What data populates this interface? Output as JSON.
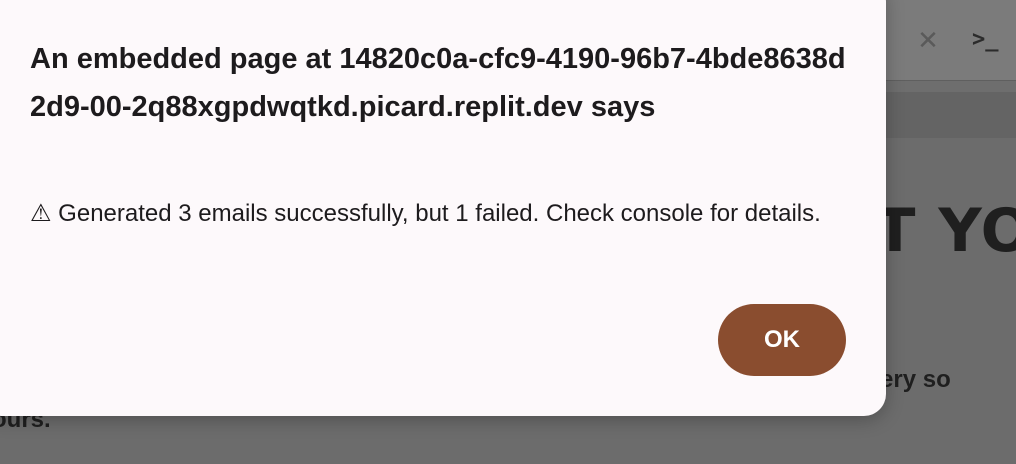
{
  "background": {
    "close_glyph": "✕",
    "terminal_glyph": ">_",
    "heading_fragment": "RT YO",
    "subtext_fragment": "elivery so",
    "subtext_fragment_2": "ours."
  },
  "dialog": {
    "title": "An embedded page at 14820c0a-cfc9-4190-96b7-4bde8638d2d9-00-2q88xgpdwqtkd.picard.replit.dev says",
    "message": "⚠ Generated 3 emails successfully, but 1 failed. Check console for details.",
    "ok_label": "OK"
  },
  "colors": {
    "dialog_bg": "#fdf9fb",
    "ok_button": "#8a4d2f",
    "overlay": "#6e6e6e"
  },
  "icons": {
    "close": "close-icon",
    "terminal": "terminal-icon",
    "warning": "warning-icon"
  }
}
